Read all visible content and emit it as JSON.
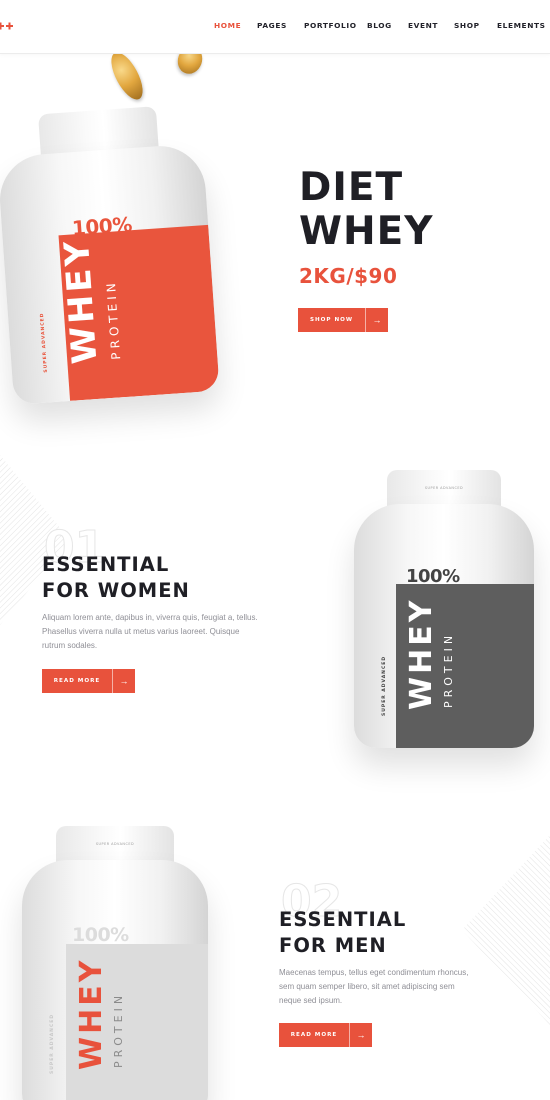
{
  "nav": {
    "logo_icon": "double-plus-logo-icon",
    "items": [
      {
        "label": "HOME",
        "active": true
      },
      {
        "label": "PAGES",
        "active": false
      },
      {
        "label": "PORTFOLIO",
        "active": false
      },
      {
        "label": "BLOG",
        "active": false
      },
      {
        "label": "EVENT",
        "active": false
      },
      {
        "label": "SHOP",
        "active": false
      },
      {
        "label": "ELEMENTS",
        "active": false
      }
    ]
  },
  "colors": {
    "accent": "#e8523c",
    "dark": "#1f1f25",
    "label_gray": "#5e5e5e",
    "label_light": "#dcdcdc",
    "muted_text": "#8f8f96"
  },
  "hero": {
    "title_line1": "DIET",
    "title_line2": "WHEY",
    "price": "2KG/$90",
    "button_label": "SHOP NOW",
    "button_icon": "arrow-right-icon"
  },
  "product_label": {
    "percent": "100%",
    "name": "WHEY",
    "sub": "PROTEIN",
    "tag": "SUPER ADVANCED"
  },
  "section_women": {
    "number": "01",
    "title_line1": "ESSENTIAL",
    "title_line2": "FOR WOMEN",
    "text_line1": "Aliquam lorem ante, dapibus in, viverra quis, feugiat a, tellus.",
    "text_line2": "Phasellus viverra nulla ut metus varius laoreet. Quisque",
    "text_line3": "rutrum sodales.",
    "button_label": "READ MORE",
    "button_icon": "arrow-right-icon"
  },
  "section_men": {
    "number": "02",
    "title_line1": "ESSENTIAL",
    "title_line2": "FOR MEN",
    "text_line1": "Maecenas tempus, tellus eget condimentum rhoncus,",
    "text_line2": "sem quam semper libero, sit amet adipiscing sem",
    "text_line3": "neque sed ipsum.",
    "button_label": "READ MORE",
    "button_icon": "arrow-right-icon"
  }
}
